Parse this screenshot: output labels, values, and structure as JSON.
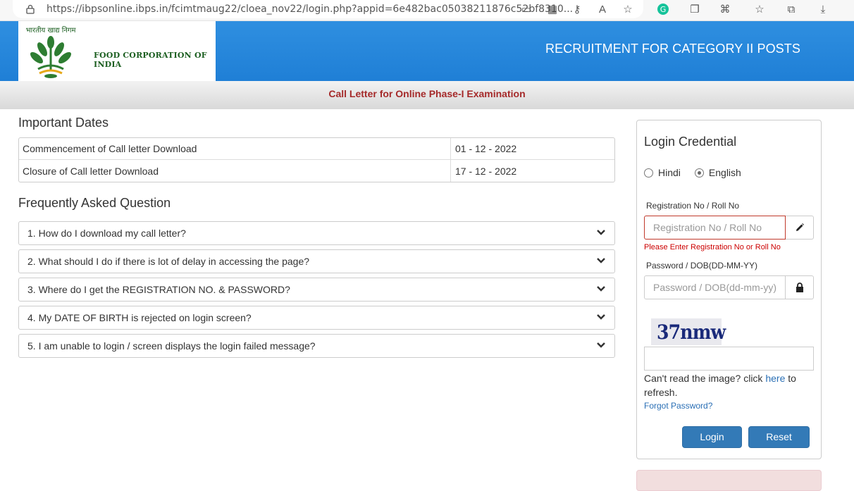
{
  "browser": {
    "url": "https://ibpsonline.ibps.in/fcimtmaug22/cloea_nov22/login.php?appid=6e482bac05038211876c52bf8310..."
  },
  "header": {
    "org_name": "FOOD CORPORATION OF INDIA",
    "logo_hindi": "भारतीय खाद्य निगम",
    "title": "RECRUITMENT FOR CATEGORY II POSTS",
    "subtitle": "Call Letter for Online Phase-I Examination"
  },
  "important_dates": {
    "heading": "Important Dates",
    "rows": [
      {
        "label": "Commencement of Call letter Download",
        "value": "01 - 12 - 2022"
      },
      {
        "label": "Closure of Call letter Download",
        "value": "17 - 12 - 2022"
      }
    ]
  },
  "faq": {
    "heading": "Frequently Asked Question",
    "items": [
      "1. How do I download my call letter?",
      "2. What should I do if there is lot of delay in accessing the page?",
      "3. Where do I get the REGISTRATION NO. & PASSWORD?",
      "4. My DATE OF BIRTH is rejected on login screen?",
      "5. I am unable to login / screen displays the login failed message?"
    ]
  },
  "login": {
    "title": "Login Credential",
    "lang_hindi": "Hindi",
    "lang_english": "English",
    "selected_language": "English",
    "reg_label": "Registration No / Roll No",
    "reg_placeholder": "Registration No / Roll No",
    "reg_error": "Please Enter Registration No or Roll No",
    "pwd_label": "Password / DOB(DD-MM-YY)",
    "pwd_placeholder": "Password / DOB(dd-mm-yy)",
    "captcha_text": "37nmw",
    "cant_read_pre": "Can't read the image? click",
    "cant_read_link": "here",
    "cant_read_post": "to refresh.",
    "forgot": "Forgot Password?",
    "login_btn": "Login",
    "reset_btn": "Reset"
  },
  "colors": {
    "header_blue": "#1f7fd6",
    "subtitle_red": "#a52a2a",
    "button_blue": "#337ab7",
    "error_red": "#cc0000"
  }
}
